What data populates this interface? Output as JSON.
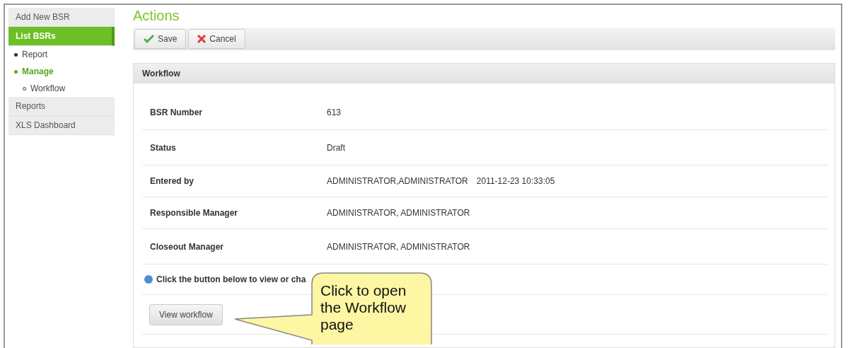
{
  "sidebar": {
    "items": [
      {
        "label": "Add New BSR",
        "selected": false
      },
      {
        "label": "List BSRs",
        "selected": true,
        "children": [
          {
            "label": "Report",
            "selected": false
          },
          {
            "label": "Manage",
            "selected": true,
            "children": [
              {
                "label": "Workflow",
                "selected": false
              }
            ]
          }
        ]
      },
      {
        "label": "Reports",
        "selected": false
      },
      {
        "label": "XLS Dashboard",
        "selected": false
      }
    ]
  },
  "page_title": "Actions",
  "toolbar": [
    {
      "kind": "save",
      "label": "Save"
    },
    {
      "kind": "cancel",
      "label": "Cancel"
    }
  ],
  "panel": {
    "title": "Workflow",
    "fields": [
      {
        "label": "BSR Number",
        "values": [
          "613"
        ]
      },
      {
        "label": "Status",
        "values": [
          "Draft"
        ]
      },
      {
        "label": "Entered by",
        "values": [
          "ADMINISTRATOR,ADMINISTRATOR",
          "2011-12-23 10:33:05"
        ]
      },
      {
        "label": "Responsible Manager",
        "values": [
          "ADMINISTRATOR, ADMINISTRATOR"
        ]
      },
      {
        "label": "Closeout Manager",
        "values": [
          "ADMINISTRATOR, ADMINISTRATOR"
        ]
      }
    ],
    "info": "Click the button below to view or cha",
    "button": "View workflow"
  },
  "callout": {
    "text": "Click to open the Workflow page"
  }
}
